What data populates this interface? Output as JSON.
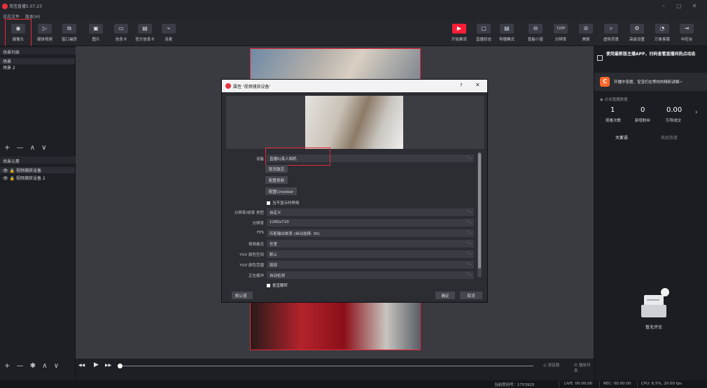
{
  "window": {
    "title": "淘宝直播5.07.23",
    "controls": [
      "–",
      "▢",
      "✕"
    ]
  },
  "menu": [
    "日志文件",
    "版本(H)"
  ],
  "toolbar": {
    "left": [
      {
        "label": "摄像头",
        "icon": "camera-icon"
      },
      {
        "label": "媒体视频",
        "icon": "play-icon"
      },
      {
        "label": "窗口捕获",
        "icon": "window-capture-icon"
      },
      {
        "label": "图片",
        "icon": "image-icon"
      },
      {
        "label": "信息卡",
        "icon": "info-card-icon"
      },
      {
        "label": "官方信息卡",
        "icon": "official-card-icon"
      },
      {
        "label": "连麦",
        "icon": "co-stream-icon"
      }
    ],
    "right": [
      {
        "label": "开始推流",
        "icon": "start-stream-icon"
      },
      {
        "label": "直播状态",
        "icon": "status-icon"
      },
      {
        "label": "导播模式",
        "icon": "director-icon"
      },
      {
        "label": "智能小窗",
        "icon": "smart-window-icon"
      },
      {
        "label": "分辨率",
        "icon": "resolution-icon",
        "badge": "720P"
      },
      {
        "label": "美颜",
        "icon": "beauty-icon"
      },
      {
        "label": "虚拟背景",
        "icon": "virtual-bg-icon"
      },
      {
        "label": "高级设置",
        "icon": "settings-icon"
      },
      {
        "label": "万象客服",
        "icon": "support-icon"
      },
      {
        "label": "中控台",
        "icon": "console-icon"
      }
    ]
  },
  "scenes": {
    "header": "场景列表",
    "items": [
      "场景",
      "场景 2"
    ],
    "controls": "+ — ∧ ∨"
  },
  "sources": {
    "header": "场景元素",
    "items": [
      "视频捕获设备",
      "视频捕获设备 2"
    ],
    "controls": "+ — ✱ ∧ ∨"
  },
  "dialog": {
    "title": "属性 '视频捕获设备'",
    "help": "?",
    "close": "✕",
    "fields": [
      {
        "label": "设备",
        "value": "直播0(真人相机"
      },
      {
        "label": "分辨率/帧率 类型",
        "value": "自定义"
      },
      {
        "label": "分辨率",
        "value": "1280x720"
      },
      {
        "label": "FPS",
        "value": "匹配输出帧率 (自动选择: 30)"
      },
      {
        "label": "视频格式",
        "value": "任意"
      },
      {
        "label": "YUV 颜色空间",
        "value": "默认"
      },
      {
        "label": "YUV 颜色范围",
        "value": "局部"
      },
      {
        "label": "正在缓冲",
        "value": "自动检测"
      }
    ],
    "buttons": [
      "取消激活",
      "配置视频",
      "配置Crossbar"
    ],
    "checkbox_hide": "当不显示时停用",
    "checkbox_flip": "垂直翻转",
    "defaults": "默认值",
    "ok": "确定",
    "cancel": "取消"
  },
  "transport": {
    "prev": "◀◀",
    "play": "▶",
    "next": "▶▶",
    "audio_mixer": "混音器",
    "playlist": "播放列表"
  },
  "right_panel": {
    "promo": "使用最新版主播APP，扫码查看直播间热点动态",
    "card": "开播中答题、宝宝们在等你的精彩讲解~",
    "stats_header": "点击隐藏数据",
    "stats": [
      {
        "value": "1",
        "label": "观看次数"
      },
      {
        "value": "0",
        "label": "新增粉丝"
      },
      {
        "value": "0.00",
        "label": "引导成交"
      }
    ],
    "tabs": [
      "大家说",
      "商品热度"
    ],
    "empty": "暂无评论",
    "accent": "#ff6a2a"
  },
  "status": {
    "room": "当前房间号：1753920",
    "live": "LIVE: 00:00:00",
    "rec": "REC: 00:00:00",
    "perf": "CPU: 6.5%, 20.00 fps"
  }
}
